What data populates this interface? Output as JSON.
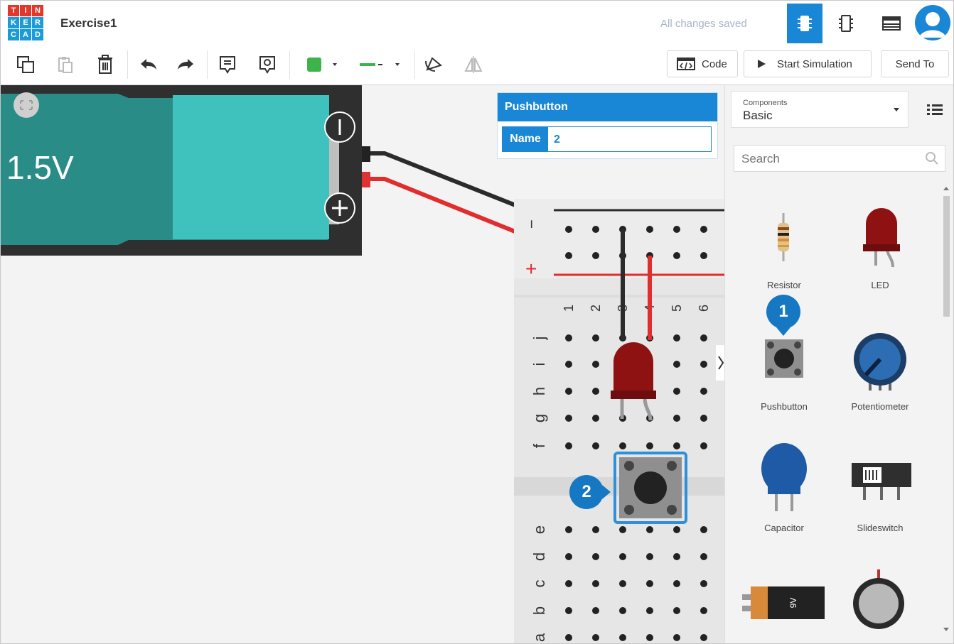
{
  "app": {
    "logo_letters": [
      "T",
      "I",
      "N",
      "K",
      "E",
      "R",
      "C",
      "A",
      "D"
    ],
    "logo_colors": [
      "#e2372b",
      "#e2372b",
      "#e2372b",
      "#1c9bd9",
      "#1c9bd9",
      "#1c9bd9",
      "#1c9bd9",
      "#1c9bd9",
      "#1c9bd9"
    ],
    "project_title": "Exercise1",
    "save_status": "All changes saved",
    "accent_color": "#1a86d6"
  },
  "view_buttons": [
    {
      "icon": "circuit-view-icon",
      "active": true
    },
    {
      "icon": "schematic-view-icon",
      "active": false
    },
    {
      "icon": "component-list-icon",
      "active": false
    }
  ],
  "toolbar": {
    "tools": [
      "copy-icon",
      "paste-icon",
      "delete-icon",
      "undo-icon",
      "redo-icon",
      "notes-icon",
      "toggle-notes-icon",
      "color-picker",
      "wire-style-picker",
      "rotate-icon",
      "flip-icon"
    ],
    "fill_color": "#3cb44b",
    "wire_color": "#3cb44b",
    "code_label": "Code",
    "start_simulation_label": "Start Simulation",
    "send_to_label": "Send To"
  },
  "canvas": {
    "battery_label": "1.5V",
    "battery_minus": "−",
    "battery_plus": "+",
    "rail_minus": "−",
    "rail_plus": "+",
    "column_numbers": [
      "1",
      "2",
      "3",
      "4",
      "5",
      "6"
    ],
    "row_letters_top": [
      "j",
      "i",
      "h",
      "g",
      "f"
    ],
    "row_letters_bottom": [
      "e",
      "d",
      "c",
      "b",
      "a"
    ]
  },
  "inspector": {
    "component_type": "Pushbutton",
    "name_label": "Name",
    "name_value": "2"
  },
  "components_panel": {
    "category_caption": "Components",
    "category_value": "Basic",
    "search_placeholder": "Search",
    "items": [
      {
        "label": "Resistor"
      },
      {
        "label": "LED"
      },
      {
        "label": "Pushbutton"
      },
      {
        "label": "Potentiometer"
      },
      {
        "label": "Capacitor"
      },
      {
        "label": "Slideswitch"
      },
      {
        "label": ""
      },
      {
        "label": ""
      }
    ],
    "battery_9v_text": "9V"
  },
  "callouts": {
    "callout_1": "1",
    "callout_2": "2"
  }
}
